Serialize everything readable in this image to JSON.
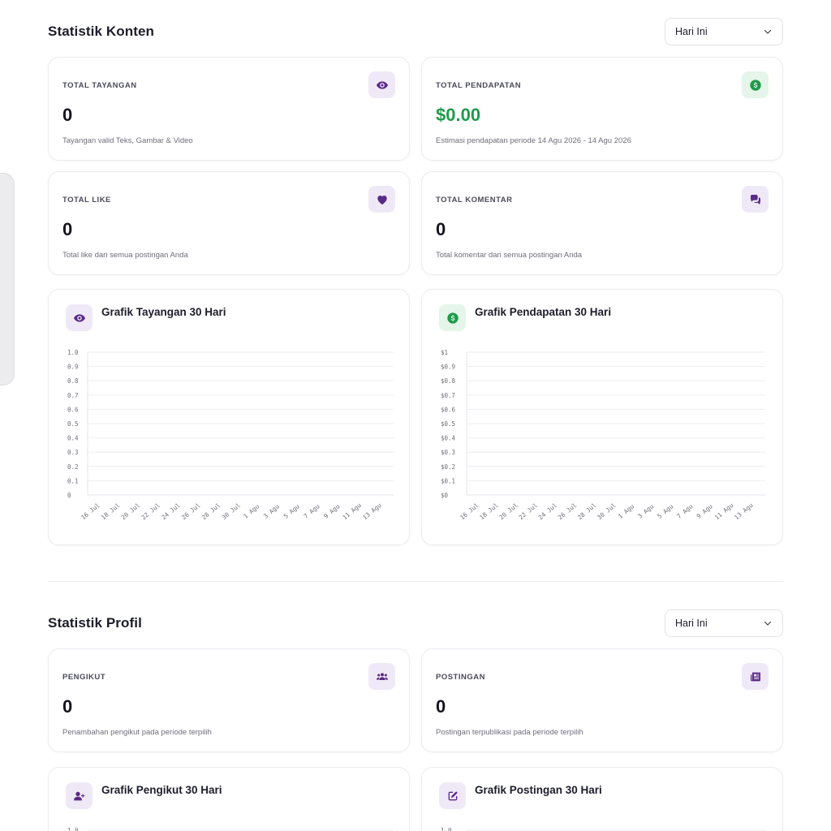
{
  "colors": {
    "accent_purple": "#5b2a86",
    "accent_green": "#1f9a4a",
    "icon_bg_purple": "#efe9f7",
    "icon_bg_green": "#e5f5ea"
  },
  "content_section": {
    "title": "Statistik Konten",
    "period_select": "Hari Ini",
    "cards": {
      "views": {
        "label": "TOTAL TAYANGAN",
        "value": "0",
        "desc": "Tayangan valid Teks, Gambar & Video",
        "icon": "eye-icon"
      },
      "earnings": {
        "label": "TOTAL PENDAPATAN",
        "value": "$0.00",
        "desc": "Estimasi pendapatan periode 14 Agu 2026 - 14 Agu 2026",
        "icon": "dollar-icon"
      },
      "likes": {
        "label": "TOTAL LIKE",
        "value": "0",
        "desc": "Total like dari semua postingan Anda",
        "icon": "heart-icon"
      },
      "comments": {
        "label": "TOTAL KOMENTAR",
        "value": "0",
        "desc": "Total komentar dari semua postingan Anda",
        "icon": "comments-icon"
      }
    },
    "charts": {
      "views": {
        "title": "Grafik Tayangan 30 Hari",
        "icon": "eye-icon"
      },
      "earnings": {
        "title": "Grafik Pendapatan 30 Hari",
        "icon": "dollar-icon"
      }
    }
  },
  "profile_section": {
    "title": "Statistik Profil",
    "period_select": "Hari Ini",
    "cards": {
      "followers": {
        "label": "PENGIKUT",
        "value": "0",
        "desc": "Penambahan pengikut pada periode terpilih",
        "icon": "users-icon"
      },
      "posts": {
        "label": "POSTINGAN",
        "value": "0",
        "desc": "Postingan terpublikasi pada periode terpilih",
        "icon": "newspaper-icon"
      }
    },
    "charts": {
      "followers": {
        "title": "Grafik Pengikut 30 Hari",
        "icon": "user-plus-icon"
      },
      "posts": {
        "title": "Grafik Postingan 30 Hari",
        "icon": "edit-icon"
      }
    }
  },
  "chart_data": [
    {
      "type": "line",
      "title": "Grafik Tayangan 30 Hari",
      "x": [
        "16 Jul",
        "18 Jul",
        "20 Jul",
        "22 Jul",
        "24 Jul",
        "26 Jul",
        "28 Jul",
        "30 Jul",
        "1 Agu",
        "3 Agu",
        "5 Agu",
        "7 Agu",
        "9 Agu",
        "11 Agu",
        "13 Agu"
      ],
      "values": [
        0,
        0,
        0,
        0,
        0,
        0,
        0,
        0,
        0,
        0,
        0,
        0,
        0,
        0,
        0
      ],
      "y_ticks": [
        "0",
        "0.1",
        "0.2",
        "0.3",
        "0.4",
        "0.5",
        "0.6",
        "0.7",
        "0.8",
        "0.9",
        "1.0"
      ],
      "ylim": [
        0,
        1
      ],
      "grid": true
    },
    {
      "type": "line",
      "title": "Grafik Pendapatan 30 Hari",
      "x": [
        "16 Jul",
        "18 Jul",
        "20 Jul",
        "22 Jul",
        "24 Jul",
        "26 Jul",
        "28 Jul",
        "30 Jul",
        "1 Agu",
        "3 Agu",
        "5 Agu",
        "7 Agu",
        "9 Agu",
        "11 Agu",
        "13 Agu"
      ],
      "values": [
        0,
        0,
        0,
        0,
        0,
        0,
        0,
        0,
        0,
        0,
        0,
        0,
        0,
        0,
        0
      ],
      "y_ticks": [
        "$0",
        "$0.1",
        "$0.2",
        "$0.3",
        "$0.4",
        "$0.5",
        "$0.6",
        "$0.7",
        "$0.8",
        "$0.9",
        "$1"
      ],
      "ylim": [
        0,
        1
      ],
      "grid": true
    }
  ],
  "partial_y_label": "1.0"
}
